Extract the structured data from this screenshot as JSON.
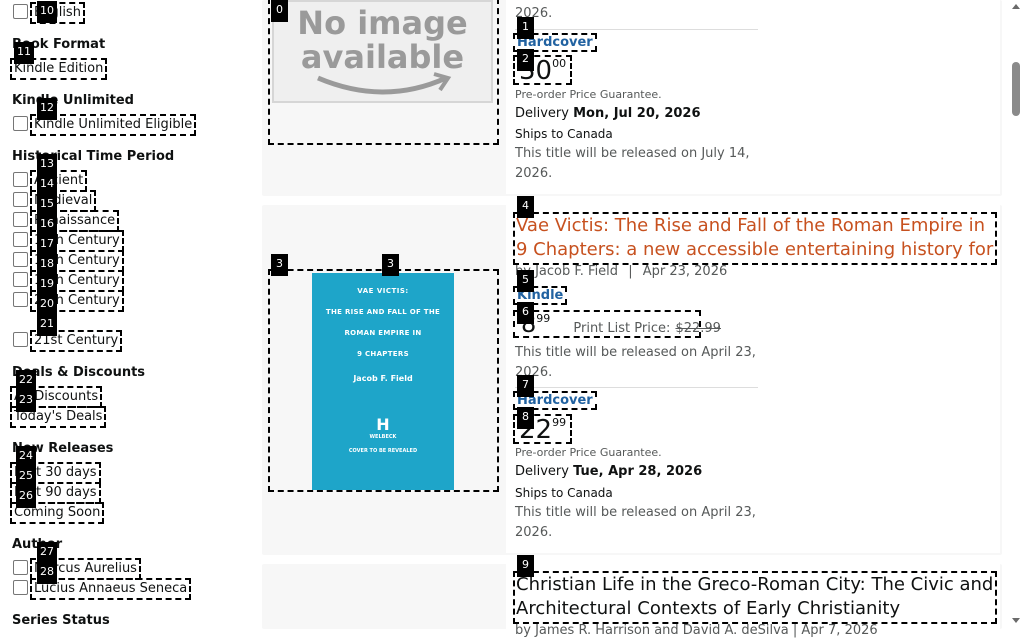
{
  "sidebar": {
    "language_item": "English",
    "book_format": {
      "heading": "Book Format",
      "items": [
        "Kindle Edition"
      ]
    },
    "kindle_unlimited": {
      "heading": "Kindle Unlimited",
      "items": [
        "Kindle Unlimited Eligible"
      ]
    },
    "historical_period": {
      "heading": "Historical Time Period",
      "items": [
        "Ancient",
        "Medieval",
        "Renaissance",
        "17th Century",
        "18th Century",
        "19th Century",
        "20th Century",
        "21st Century"
      ]
    },
    "deals": {
      "heading": "Deals & Discounts",
      "items": [
        "All Discounts",
        "Today's Deals"
      ]
    },
    "new_releases": {
      "heading": "New Releases",
      "items": [
        "Last 30 days",
        "Last 90 days",
        "Coming Soon"
      ]
    },
    "author": {
      "heading": "Author",
      "items": [
        "Marcus Aurelius",
        "Lucius Annaeus Seneca"
      ]
    },
    "series_status": {
      "heading": "Series Status"
    }
  },
  "results": {
    "first": {
      "image_text": "No image available",
      "top_release_text": "2026.",
      "hardcover_label": "Hardcover",
      "price_whole": "30",
      "price_fraction": "00",
      "preorder": "Pre-order Price Guarantee.",
      "delivery_label": "Delivery",
      "delivery_date": "Mon, Jul 20, 2026",
      "ships": "Ships to Canada",
      "release": "This title will be released on July 14, 2026."
    },
    "second": {
      "title": "Vae Victis: The Rise and Fall of the Roman Empire in 9 Chapters: a new accessible entertaining history for anyo…",
      "by": "by",
      "author": "Jacob F. Field",
      "separator": "|",
      "date": "Apr 23, 2026",
      "cover": {
        "line1": "VAE VICTIS:",
        "line2": "THE RISE AND FALL OF THE",
        "line3": "ROMAN EMPIRE IN",
        "line4": "9 CHAPTERS",
        "author": "Jacob F. Field",
        "publisher": "H",
        "publisher_sub": "WELBECK",
        "footer": "COVER TO BE REVEALED"
      },
      "kindle_label": "Kindle",
      "kindle_price_whole": "8",
      "kindle_price_fraction": "99",
      "list_price_label": "Print List Price:",
      "list_price": "$22.99",
      "kindle_release": "This title will be released on April 23, 2026.",
      "hardcover_label": "Hardcover",
      "hc_price_whole": "22",
      "hc_price_fraction": "99",
      "preorder": "Pre-order Price Guarantee.",
      "delivery_label": "Delivery",
      "delivery_date": "Tue, Apr 28, 2026",
      "ships": "Ships to Canada",
      "hc_release": "This title will be released on April 23, 2026."
    },
    "third": {
      "title": "Christian Life in the Greco-Roman City: The Civic and Architectural Contexts of Early Christianity",
      "byline": "by James R. Harrison and David A. deSilva | Apr 7, 2026"
    }
  },
  "markers": [
    "0",
    "1",
    "2",
    "3",
    "3",
    "4",
    "5",
    "6",
    "7",
    "8",
    "9",
    "10",
    "11",
    "12",
    "13",
    "14",
    "15",
    "16",
    "17",
    "18",
    "19",
    "20",
    "21",
    "22",
    "23",
    "24",
    "25",
    "26",
    "27",
    "28"
  ],
  "colors": {
    "link": "#2162A1",
    "title": "#C7511F",
    "cover_bg": "#1ea5c9"
  }
}
